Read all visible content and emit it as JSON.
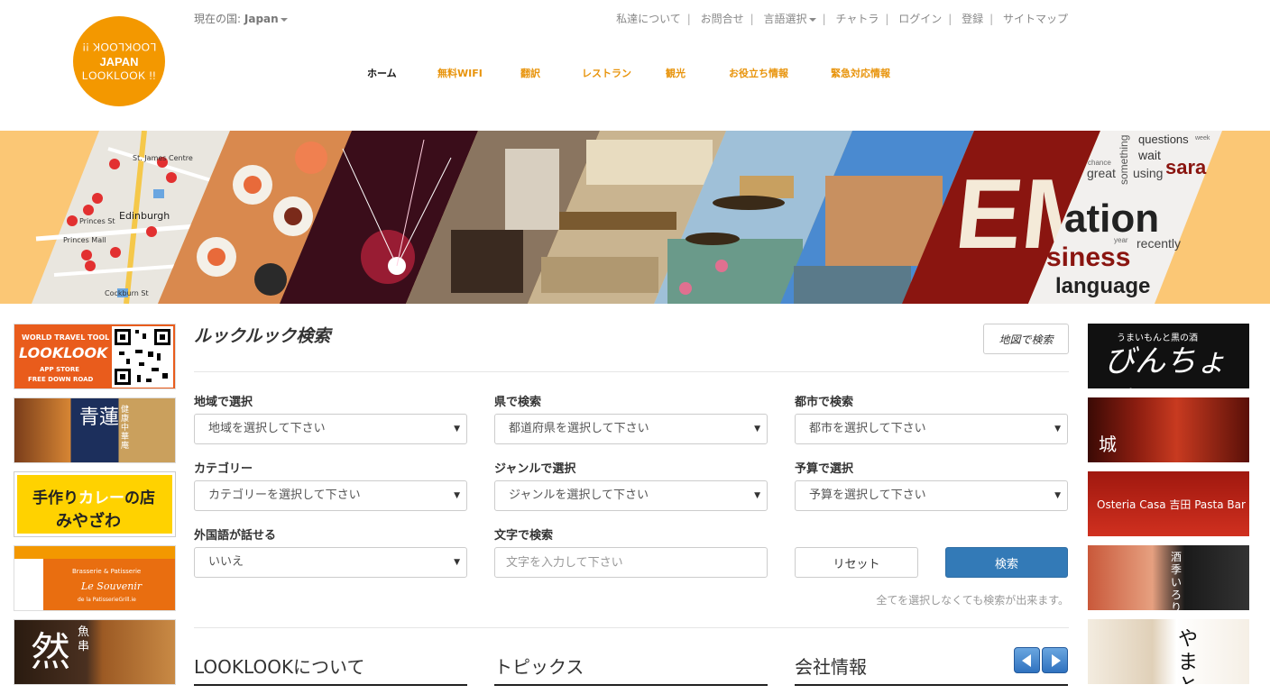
{
  "logo": {
    "line1": "LOOKLOOK !!",
    "line2": "JAPAN",
    "line3": "LOOKLOOK !!"
  },
  "country": {
    "label": "現在の国:",
    "value": "Japan"
  },
  "topnav": {
    "items": [
      "私達について",
      "お問合せ",
      "言語選択",
      "チャトラ",
      "ログイン",
      "登録",
      "サイトマップ"
    ]
  },
  "mainnav": {
    "items": [
      "ホーム",
      "無料WIFI",
      "翻訳",
      "レストラン",
      "観光",
      "お役立ち情報",
      "緊急対応情報"
    ]
  },
  "banner": {
    "map_labels": [
      "St. James Centre",
      "Edinburgh",
      "Princes St",
      "Princes Mall",
      "Cockburn St"
    ],
    "sign_text": "EMI",
    "words": [
      "questions",
      "wait",
      "sara",
      "great",
      "using",
      "ation",
      "recently",
      "siness",
      "language",
      "something",
      "chance",
      "week",
      "year"
    ]
  },
  "left_ads": {
    "ad1": {
      "t1": "WORLD TRAVEL TOOL",
      "t2": "LOOKLOOK",
      "t3": "APP STORE",
      "t4": "FREE DOWN ROAD"
    },
    "ad2": {
      "title": "青蓮",
      "sub": "健康中華庵"
    },
    "ad3": {
      "t1a": "手作り",
      "t1b": "カレー",
      "t1c": "の店",
      "t2": "みやざわ"
    },
    "ad4": {
      "t1": "Brasserie & Patisserie",
      "t2": "Le Souvenir",
      "t3": "de la PatisserieGrill.ie"
    },
    "ad5": {
      "title": "然",
      "sub": "魚串"
    }
  },
  "right_ads": {
    "ad1": {
      "sub": "うまいもんと黒の酒",
      "title": "びんちょろ"
    },
    "ad2": {
      "title": "城"
    },
    "ad3": {
      "title": "Osteria Casa 吉田 Pasta Bar"
    },
    "ad4": {
      "title": "酒季いろり"
    },
    "ad5": {
      "title": "やまと"
    }
  },
  "search": {
    "title": "ルックルック検索",
    "map_button": "地図で検索",
    "fields": {
      "region": {
        "label": "地域で選択",
        "value": "地域を選択して下さい"
      },
      "prefecture": {
        "label": "県で検索",
        "value": "都道府県を選択して下さい"
      },
      "city": {
        "label": "都市で検索",
        "value": "都市を選択して下さい"
      },
      "category": {
        "label": "カテゴリー",
        "value": "カテゴリーを選択して下さい"
      },
      "genre": {
        "label": "ジャンルで選択",
        "value": "ジャンルを選択して下さい"
      },
      "budget": {
        "label": "予算で選択",
        "value": "予算を選択して下さい"
      },
      "language": {
        "label": "外国語が話せる",
        "value": "いいえ"
      },
      "keyword": {
        "label": "文字で検索",
        "placeholder": "文字を入力して下さい"
      }
    },
    "reset_button": "リセット",
    "search_button": "検索",
    "note": "全てを選択しなくても検索が出来ます。"
  },
  "sections": {
    "about": "LOOKLOOKについて",
    "topics": "トピックス",
    "company": "会社情報"
  },
  "colors": {
    "brand_orange": "#f39800",
    "banner_bg": "#fbc775",
    "primary_blue": "#337ab7"
  }
}
